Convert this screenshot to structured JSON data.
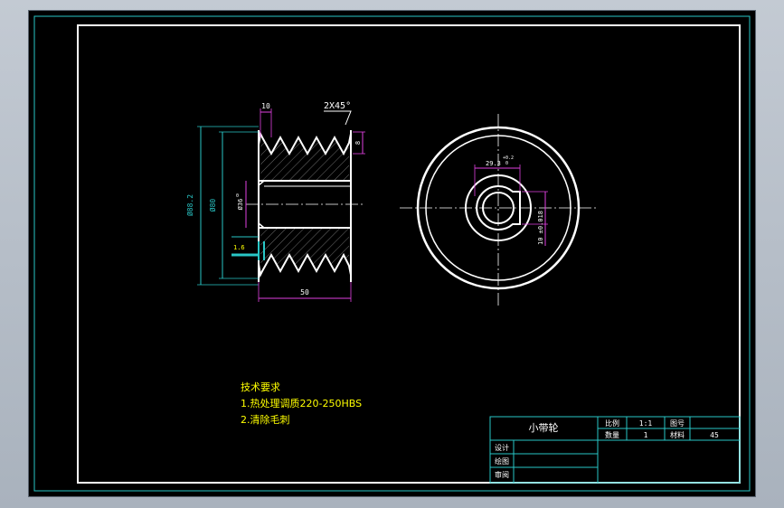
{
  "drawing": {
    "dims": {
      "groove_width": "10",
      "chamfer": "2X45°",
      "groove_depth": "8",
      "od": "Ø88.2",
      "pitch_d": "Ø80",
      "bore": "Ø36",
      "bore_tol_top": "0",
      "bore_tol_bot": "-0",
      "roughness": "1.6",
      "length": "50",
      "key_depth": "29.3",
      "key_tol_top": "+0.2",
      "key_tol_bot": "0",
      "key_width": "10 ±0.018"
    },
    "notes": {
      "title": "技术要求",
      "line1": "1.热处理调质220-250HBS",
      "line2": "2.清除毛刺"
    },
    "title_block": {
      "part_name": "小带轮",
      "scale_label": "比例",
      "scale_value": "1:1",
      "drawing_no_label": "图号",
      "qty_label": "数量",
      "qty_value": "1",
      "material_label": "材料",
      "material_value": "45",
      "designer_label": "设计",
      "drafter_label": "绘图",
      "reviewer_label": "审阅"
    }
  }
}
